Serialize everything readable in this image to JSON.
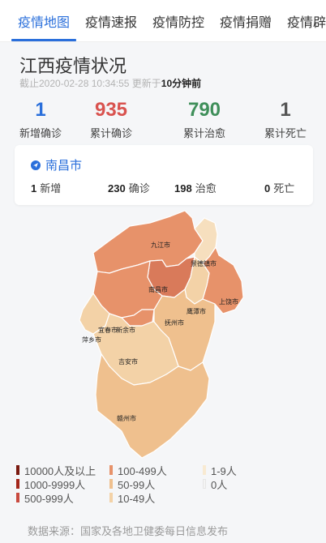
{
  "tabs": [
    {
      "label": "疫情地图",
      "active": true
    },
    {
      "label": "疫情速报",
      "active": false
    },
    {
      "label": "疫情防控",
      "active": false
    },
    {
      "label": "疫情捐赠",
      "active": false
    },
    {
      "label": "疫情辟谣",
      "active": false
    }
  ],
  "header": {
    "title": "江西疫情状况",
    "updated_prefix": "截止2020-02-28 10:34:55 更新于",
    "updated_ago": "10分钟前"
  },
  "stats": [
    {
      "value": "1",
      "label": "新增确诊",
      "color": "#2a6fdb"
    },
    {
      "value": "935",
      "label": "累计确诊",
      "color": "#d9534f"
    },
    {
      "value": "790",
      "label": "累计治愈",
      "color": "#3f8f5a"
    },
    {
      "value": "1",
      "label": "累计死亡",
      "color": "#555555"
    }
  ],
  "city_card": {
    "name": "南昌市",
    "icon": "location-icon",
    "new": {
      "value": "1",
      "label": "新增"
    },
    "confirmed": {
      "value": "230",
      "label": "确诊"
    },
    "cured": {
      "value": "198",
      "label": "治愈"
    },
    "deaths": {
      "value": "0",
      "label": "死亡"
    }
  },
  "map": {
    "cities": [
      {
        "name": "九江市",
        "color": "#e7926a"
      },
      {
        "name": "景德镇市",
        "color": "#f6dfbe"
      },
      {
        "name": "南昌市",
        "color": "#d97a5a"
      },
      {
        "name": "上饶市",
        "color": "#e7926a"
      },
      {
        "name": "鹰潭市",
        "color": "#f3d2a7"
      },
      {
        "name": "抚州市",
        "color": "#efc08e"
      },
      {
        "name": "宜春市",
        "color": "#e7926a"
      },
      {
        "name": "新余市",
        "color": "#e7926a"
      },
      {
        "name": "萍乡市",
        "color": "#f3d2a7"
      },
      {
        "name": "吉安市",
        "color": "#f3d2a7"
      },
      {
        "name": "赣州市",
        "color": "#efc08e"
      }
    ]
  },
  "legend": [
    {
      "label": "10000人及以上",
      "color": "#7a1a10"
    },
    {
      "label": "1000-9999人",
      "color": "#a3261b"
    },
    {
      "label": "500-999人",
      "color": "#c94a3f"
    },
    {
      "label": "100-499人",
      "color": "#e7926a"
    },
    {
      "label": "50-99人",
      "color": "#efc08e"
    },
    {
      "label": "10-49人",
      "color": "#f3d2a7"
    },
    {
      "label": "1-9人",
      "color": "#f8ead2"
    },
    {
      "label": "0人",
      "color": "#f4f4f4"
    }
  ],
  "source": "数据来源：国家及各地卫健委每日信息发布"
}
